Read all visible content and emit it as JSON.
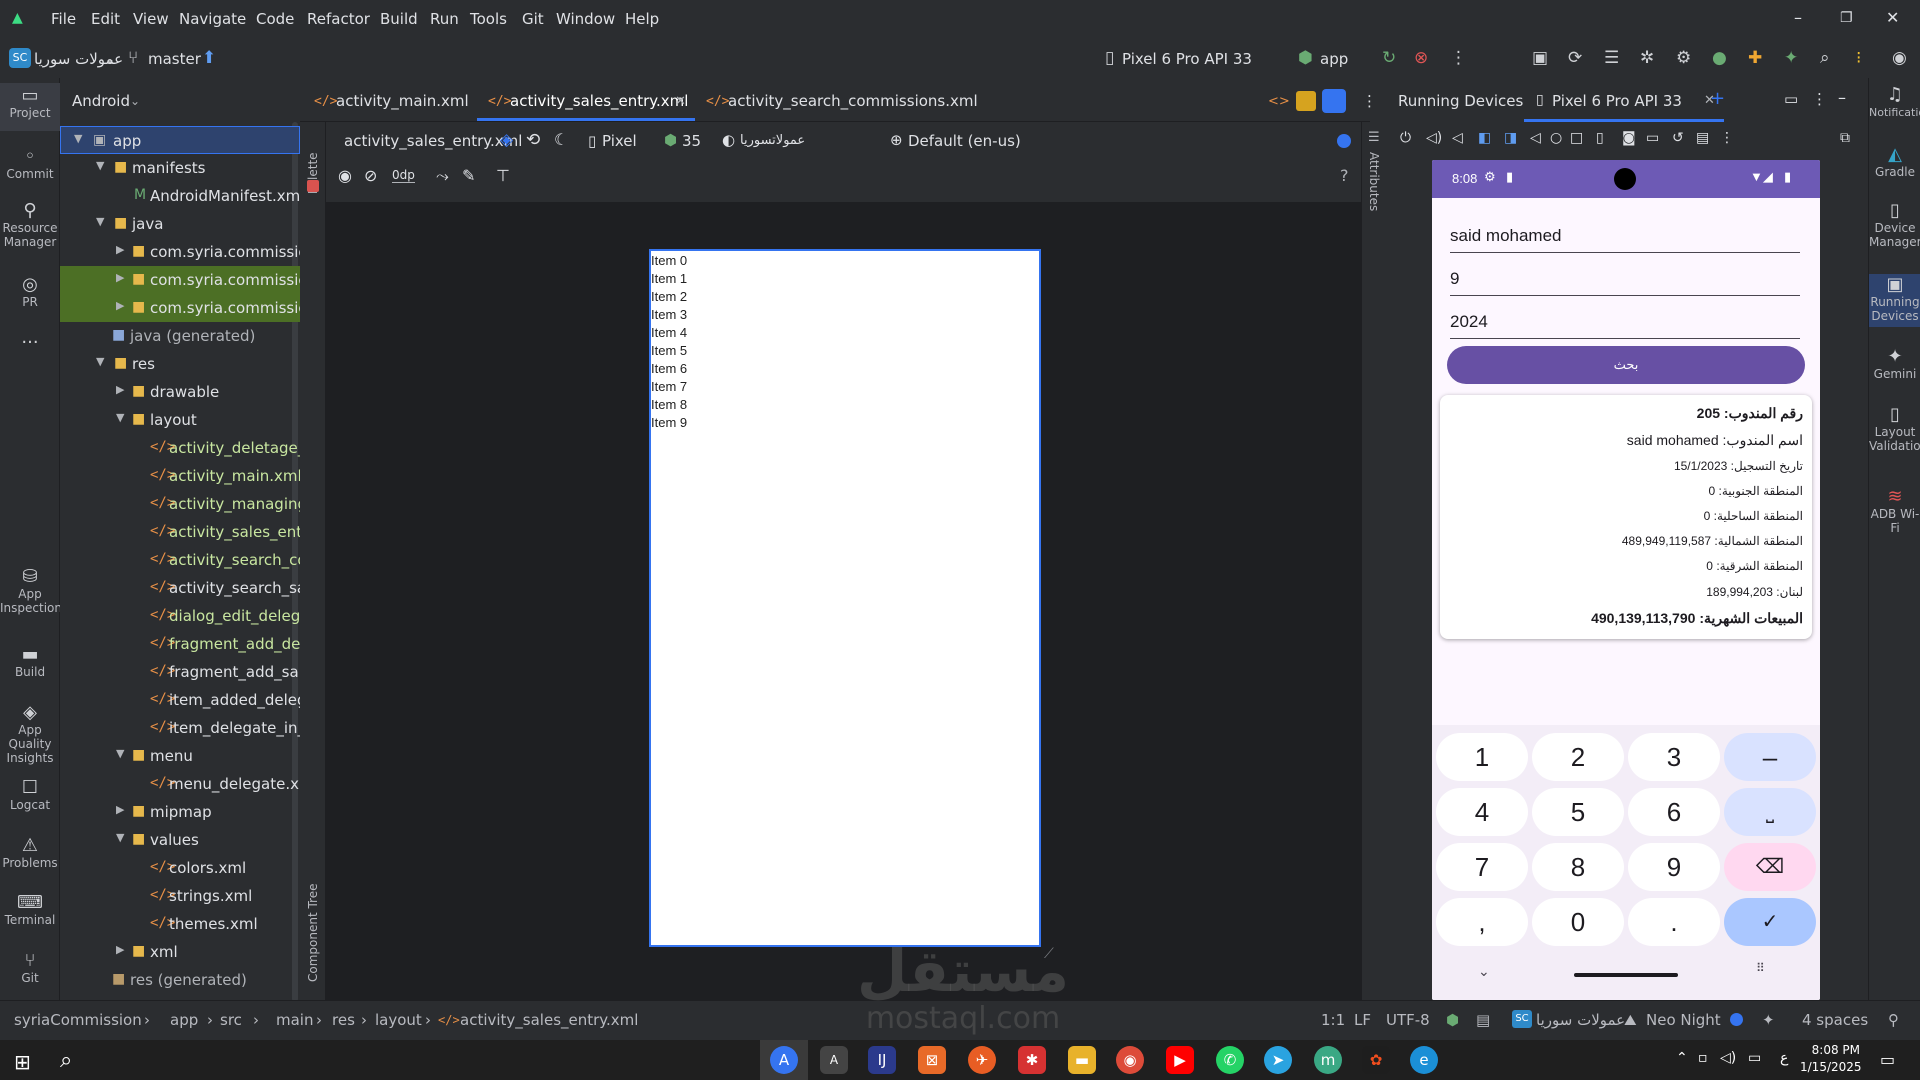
{
  "menu": [
    "File",
    "Edit",
    "View",
    "Navigate",
    "Code",
    "Refactor",
    "Build",
    "Run",
    "Tools",
    "Git",
    "Window",
    "Help"
  ],
  "toolbar": {
    "project_badge": "SC",
    "project_name": "عمولات سوريا",
    "branch": "master",
    "device": "Pixel 6 Pro API 33",
    "run_config": "app"
  },
  "left_strip": {
    "items": [
      "Project",
      "Commit",
      "Resource Manager",
      "PR",
      "App Inspection",
      "Build",
      "App Quality Insights",
      "Logcat",
      "Problems",
      "Terminal",
      "Git"
    ]
  },
  "project_panel": {
    "view": "Android",
    "tree": [
      {
        "label": "app"
      },
      {
        "label": "manifests"
      },
      {
        "label": "AndroidManifest.xml"
      },
      {
        "label": "java"
      },
      {
        "label": "com.syria.commissions"
      },
      {
        "label": "com.syria.commissions"
      },
      {
        "label": "com.syria.commissions"
      },
      {
        "label": "java (generated)"
      },
      {
        "label": "res"
      },
      {
        "label": "drawable"
      },
      {
        "label": "layout"
      },
      {
        "label": "activity_deletage_pr"
      },
      {
        "label": "activity_main.xml"
      },
      {
        "label": "activity_managing_d"
      },
      {
        "label": "activity_sales_entry.:"
      },
      {
        "label": "activity_search_com"
      },
      {
        "label": "activity_search_sales"
      },
      {
        "label": "dialog_edit_delegate"
      },
      {
        "label": "fragment_add_deleg"
      },
      {
        "label": "fragment_add_sales_"
      },
      {
        "label": "item_added_delegat"
      },
      {
        "label": "item_delegate_in_sal"
      },
      {
        "label": "menu"
      },
      {
        "label": "menu_delegate.xml"
      },
      {
        "label": "mipmap"
      },
      {
        "label": "values"
      },
      {
        "label": "colors.xml"
      },
      {
        "label": "strings.xml"
      },
      {
        "label": "themes.xml"
      },
      {
        "label": "xml"
      },
      {
        "label": "res (generated)"
      }
    ]
  },
  "editor": {
    "tabs": [
      "activity_main.xml",
      "activity_sales_entry.xml",
      "activity_search_commissions.xml"
    ],
    "active_tab": "activity_sales_entry.xml",
    "design_file": "activity_sales_entry.xml",
    "device": "Pixel",
    "api": "35",
    "theme": "عمولاتسوريا",
    "locale": "Default (en-us)",
    "margin": "0dp",
    "palette_label": "Palette",
    "component_tree_label": "Component Tree",
    "attributes_label": "Attributes",
    "list_items": [
      "Item 0",
      "Item 1",
      "Item 2",
      "Item 3",
      "Item 4",
      "Item 5",
      "Item 6",
      "Item 7",
      "Item 8",
      "Item 9"
    ]
  },
  "devices_panel": {
    "title": "Running Devices",
    "tab": "Pixel 6 Pro API 33"
  },
  "phone": {
    "time": "8:08",
    "fields": [
      "said mohamed",
      "9",
      "2024"
    ],
    "search_button": "بحث",
    "card": {
      "rep_number_label": "رقم المندوب:",
      "rep_number": "205",
      "rep_name_label": "اسم المندوب:",
      "rep_name": "said mohamed",
      "reg_date_label": "تاريخ التسجيل:",
      "reg_date": "15/1/2023",
      "south_label": "المنطقة الجنوبية:",
      "south": "0",
      "coastal_label": "المنطقة الساحلية:",
      "coastal": "0",
      "north_label": "المنطقة الشمالية:",
      "north": "489,949,119,587",
      "east_label": "المنطقة الشرقية:",
      "east": "0",
      "lebanon_label": "لبنان:",
      "lebanon": "189,994,203",
      "monthly_label": "المبيعات الشهرية:",
      "monthly": "490,139,113,790"
    },
    "keys": [
      "1",
      "2",
      "3",
      "–",
      "4",
      "5",
      "6",
      "⎵",
      "7",
      "8",
      "9",
      "⌫",
      ",",
      "0",
      ".",
      "✓"
    ]
  },
  "right_strip": {
    "items": [
      "Notifications",
      "Gradle",
      "Device Manager",
      "Running Devices",
      "Gemini",
      "Layout Validation",
      "ADB Wi-Fi"
    ]
  },
  "status_bar": {
    "breadcrumb": [
      "syriaCommission",
      "app",
      "src",
      "main",
      "res",
      "layout",
      "activity_sales_entry.xml"
    ],
    "position": "1:1",
    "line_sep": "LF",
    "encoding": "UTF-8",
    "project_badge": "SC",
    "project_name": "عمولات سوريا",
    "theme": "Neo Night",
    "indent": "4 spaces"
  },
  "taskbar": {
    "time": "8:08 PM",
    "date": "1/15/2025",
    "lang": "ع"
  },
  "watermark": {
    "arabic": "مستقل",
    "latin": "mostaql.com"
  }
}
